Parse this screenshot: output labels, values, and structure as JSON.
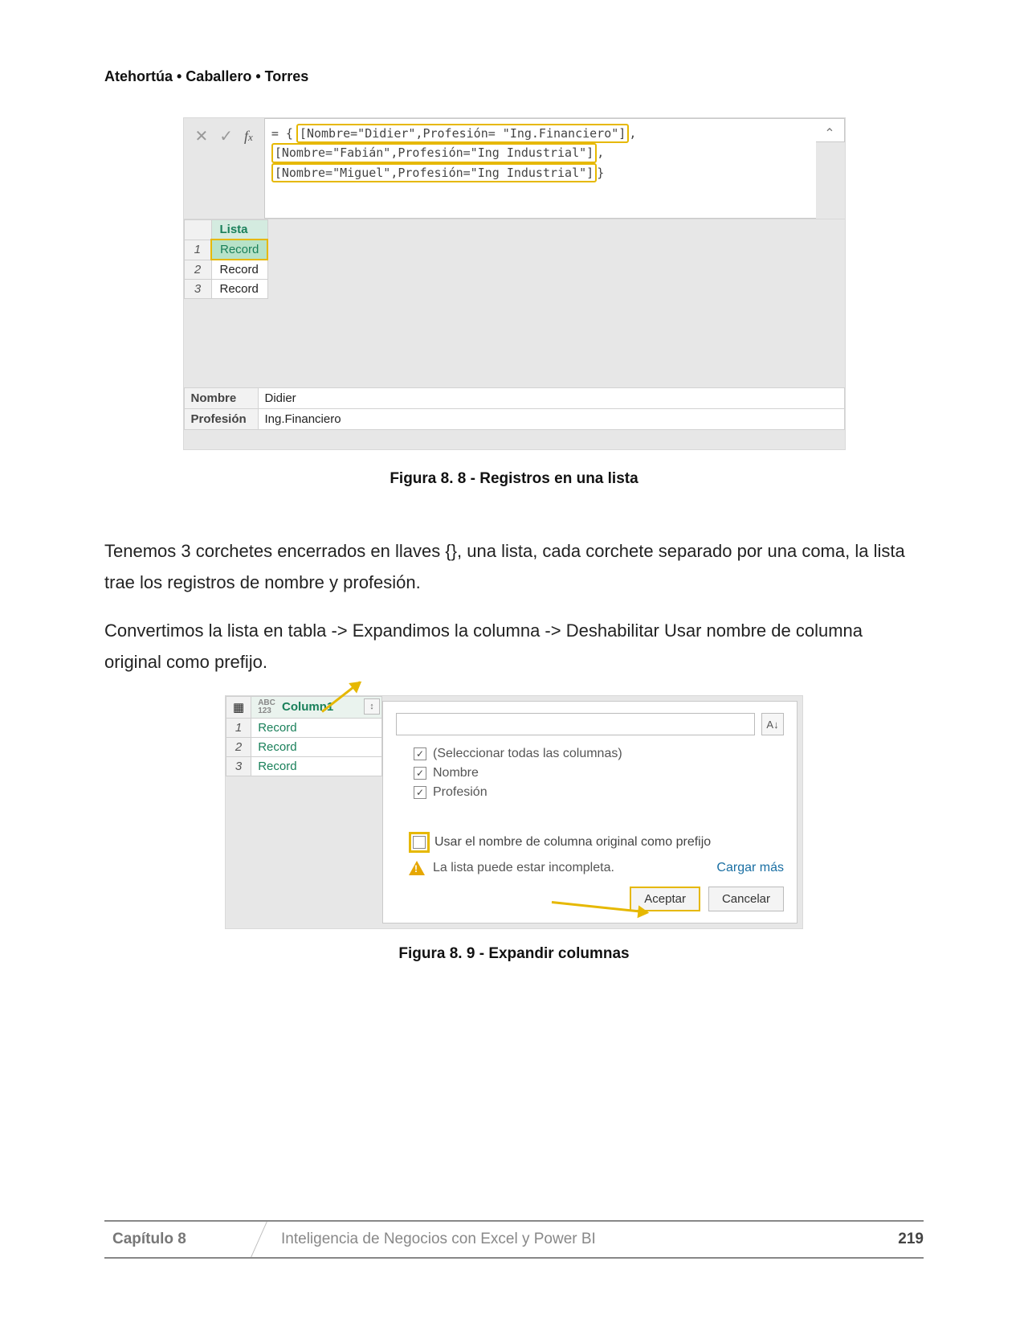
{
  "authors": "Atehortúa • Caballero • Torres",
  "fig88": {
    "formula_prefix": "= {",
    "formula_lines": [
      "[Nombre=\"Didier\",Profesión= \"Ing.Financiero\"]",
      "[Nombre=\"Fabián\",Profesión=\"Ing Industrial\"]",
      "[Nombre=\"Miguel\",Profesión=\"Ing Industrial\"]"
    ],
    "formula_closer": "}",
    "list_header": "Lista",
    "rows": [
      "Record",
      "Record",
      "Record"
    ],
    "detail": {
      "nombre_label": "Nombre",
      "nombre_value": "Didier",
      "prof_label": "Profesión",
      "prof_value": "Ing.Financiero"
    },
    "caption": "Figura 8. 8 - Registros en una lista"
  },
  "para1": "Tenemos 3 corchetes encerrados en llaves {}, una lista, cada corchete separado por una coma, la lista trae los registros de nombre y profesión.",
  "para2": "Convertimos la lista en tabla -> Expandimos la columna -> Deshabilitar Usar nombre de columna original como prefijo.",
  "fig89": {
    "column_header": "Column1",
    "rows": [
      "Record",
      "Record",
      "Record"
    ],
    "options": {
      "select_all": "(Seleccionar todas las columnas)",
      "nombre": "Nombre",
      "profesion": "Profesión"
    },
    "prefix_label": "Usar el nombre de columna original como prefijo",
    "warning": "La lista puede estar incompleta.",
    "load_more": "Cargar más",
    "accept": "Aceptar",
    "cancel": "Cancelar",
    "caption": "Figura 8. 9 - Expandir columnas"
  },
  "footer": {
    "chapter": "Capítulo 8",
    "title": "Inteligencia de Negocios con Excel y Power BI",
    "page": "219"
  }
}
